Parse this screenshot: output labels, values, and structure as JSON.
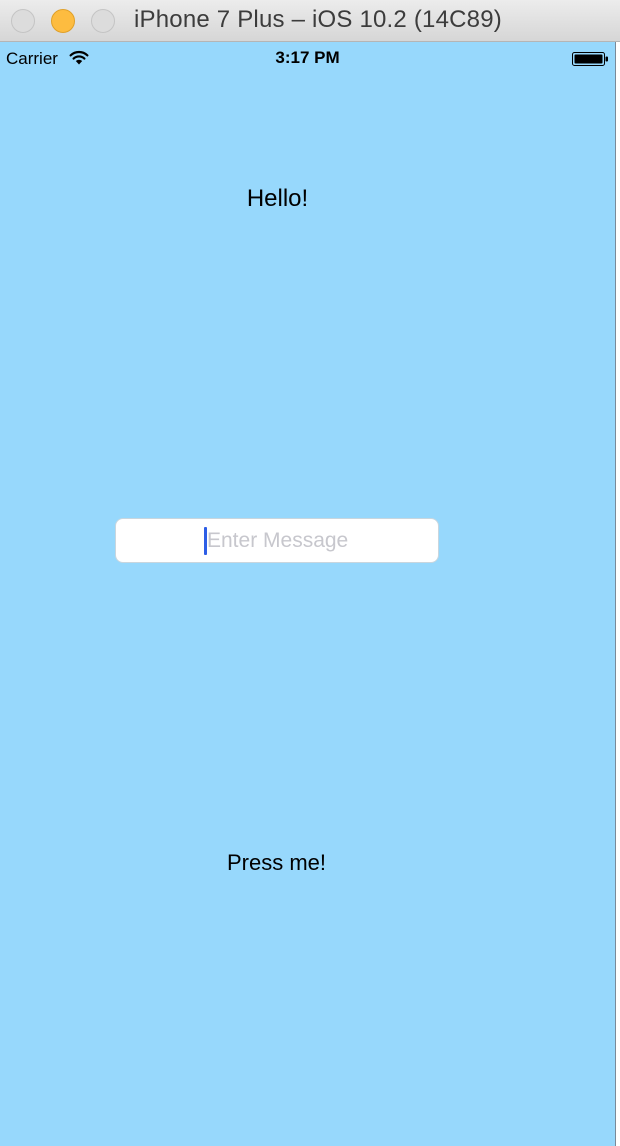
{
  "window": {
    "title": "iPhone 7 Plus – iOS 10.2 (14C89)"
  },
  "status_bar": {
    "carrier": "Carrier",
    "time": "3:17 PM",
    "icons": [
      "wifi-icon",
      "battery-icon"
    ]
  },
  "main": {
    "label": "Hello!",
    "text_field": {
      "placeholder": "Enter Message",
      "value": ""
    },
    "button_label": "Press me!"
  },
  "colors": {
    "background": "#97d8fc",
    "caret": "#2d5ee6",
    "placeholder": "#c7c7cd",
    "minimize_button": "#fdbc40"
  }
}
